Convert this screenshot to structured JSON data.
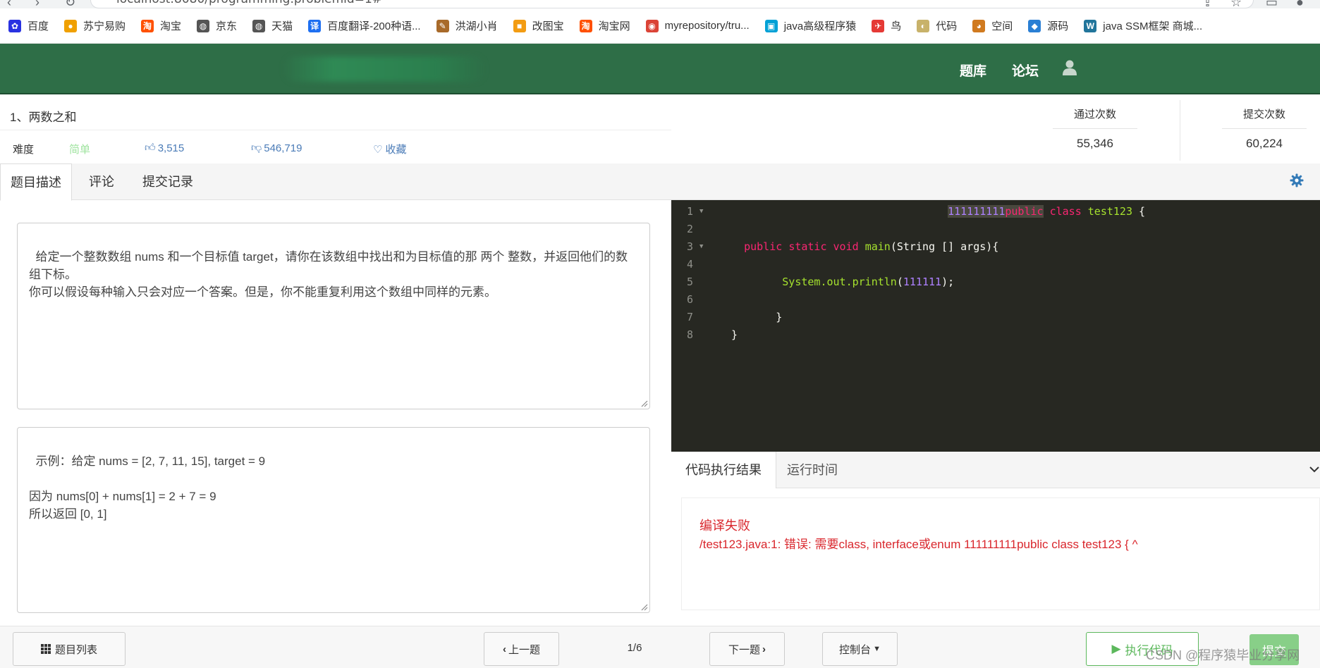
{
  "browser": {
    "url": "localhost:8080/programming.problemid=1#"
  },
  "bookmarks": [
    {
      "label": "百度",
      "icon": "baidu-icon",
      "color": "#2932e1",
      "glyph": "✿"
    },
    {
      "label": "苏宁易购",
      "icon": "suning-icon",
      "color": "#f0a000",
      "glyph": "●"
    },
    {
      "label": "淘宝",
      "icon": "taobao-icon",
      "color": "#ff5000",
      "glyph": "淘"
    },
    {
      "label": "京东",
      "icon": "globe-icon",
      "color": "#555555",
      "glyph": "◍"
    },
    {
      "label": "天猫",
      "icon": "globe-icon",
      "color": "#555555",
      "glyph": "◍"
    },
    {
      "label": "百度翻译-200种语...",
      "icon": "translate-icon",
      "color": "#1e6ff1",
      "glyph": "译"
    },
    {
      "label": "洪湖小肖",
      "icon": "bird-icon",
      "color": "#a86a2a",
      "glyph": "✎"
    },
    {
      "label": "改图宝",
      "icon": "gaitubao-icon",
      "color": "#f39c12",
      "glyph": "■"
    },
    {
      "label": "淘宝网",
      "icon": "taobao-icon",
      "color": "#ff5000",
      "glyph": "淘"
    },
    {
      "label": "myrepository/tru...",
      "icon": "chrome-icon",
      "color": "#db4437",
      "glyph": "◉"
    },
    {
      "label": "java高级程序猿",
      "icon": "bilibili-icon",
      "color": "#00a1d6",
      "glyph": "▣"
    },
    {
      "label": "鸟",
      "icon": "bird-icon",
      "color": "#e53935",
      "glyph": "✈"
    },
    {
      "label": "代码",
      "icon": "code-icon",
      "color": "#c8b26a",
      "glyph": "◐"
    },
    {
      "label": "空间",
      "icon": "space-icon",
      "color": "#d07a1f",
      "glyph": "◕"
    },
    {
      "label": "源码",
      "icon": "source-icon",
      "color": "#2a7fd4",
      "glyph": "◆"
    },
    {
      "label": "java SSM框架 商城...",
      "icon": "wordpress-icon",
      "color": "#21759b",
      "glyph": "W"
    }
  ],
  "header": {
    "nav": [
      "题库",
      "论坛"
    ]
  },
  "problem": {
    "title": "1、两数之和",
    "difficulty_label": "难度",
    "difficulty": "简单",
    "likes": "3,515",
    "dislikes": "546,719",
    "favorite": "收藏",
    "pass_label": "通过次数",
    "pass_count": "55,346",
    "submit_label": "提交次数",
    "submit_count": "60,224"
  },
  "tabs": [
    "题目描述",
    "评论",
    "提交记录"
  ],
  "description": "给定一个整数数组 nums 和一个目标值 target，请你在该数组中找出和为目标值的那 两个 整数，并返回他们的数组下标。\n你可以假设每种输入只会对应一个答案。但是，你不能重复利用这个数组中同样的元素。",
  "example": "示例：给定 nums = [2, 7, 11, 15], target = 9\n\n因为 nums[0] + nums[1] = 2 + 7 = 9\n所以返回 [0, 1]",
  "code_lines": [
    {
      "n": "1",
      "fold": true,
      "indent": "                                   ",
      "tokens": [
        {
          "t": "111111111",
          "c": "tok-num tok-sel"
        },
        {
          "t": "public",
          "c": "tok-kw tok-sel"
        },
        {
          "t": " ",
          "c": "tok-pl"
        },
        {
          "t": "class",
          "c": "tok-kw"
        },
        {
          "t": " ",
          "c": "tok-pl"
        },
        {
          "t": "test123",
          "c": "tok-cls"
        },
        {
          "t": " {",
          "c": "tok-pl"
        }
      ]
    },
    {
      "n": "2",
      "fold": false,
      "indent": "",
      "tokens": []
    },
    {
      "n": "3",
      "fold": true,
      "indent": "   ",
      "tokens": [
        {
          "t": "public",
          "c": "tok-kw"
        },
        {
          "t": " ",
          "c": "tok-pl"
        },
        {
          "t": "static",
          "c": "tok-kw"
        },
        {
          "t": " ",
          "c": "tok-pl"
        },
        {
          "t": "void",
          "c": "tok-kw"
        },
        {
          "t": " ",
          "c": "tok-pl"
        },
        {
          "t": "main",
          "c": "tok-cls"
        },
        {
          "t": "(String [] args){",
          "c": "tok-pl"
        }
      ]
    },
    {
      "n": "4",
      "fold": false,
      "indent": "",
      "tokens": []
    },
    {
      "n": "5",
      "fold": false,
      "indent": "         ",
      "tokens": [
        {
          "t": "System.out.println",
          "c": "tok-cls"
        },
        {
          "t": "(",
          "c": "tok-pl"
        },
        {
          "t": "111111",
          "c": "tok-num"
        },
        {
          "t": ");",
          "c": "tok-pl"
        }
      ]
    },
    {
      "n": "6",
      "fold": false,
      "indent": "",
      "tokens": []
    },
    {
      "n": "7",
      "fold": false,
      "indent": "        ",
      "tokens": [
        {
          "t": "}",
          "c": "tok-pl"
        }
      ]
    },
    {
      "n": "8",
      "fold": false,
      "indent": " ",
      "tokens": [
        {
          "t": "}",
          "c": "tok-pl"
        }
      ]
    }
  ],
  "result": {
    "tabs": [
      "代码执行结果",
      "运行时间"
    ],
    "status": "编译失败",
    "message": "/test123.java:1: 错误: 需要class, interface或enum 111111111public class test123 { ^"
  },
  "footer": {
    "list_button": "题目列表",
    "prev_button": "上一题",
    "pager": "1/6",
    "next_button": "下一题",
    "console_button": "控制台",
    "run_button": "执行代码",
    "submit_button": "提交"
  },
  "watermark": "CSDN @程序猿毕业分享网",
  "colors": {
    "header_green": "#2e6e47",
    "difficulty_green": "#5cb85c",
    "link_blue": "#4a7bb7",
    "error_red": "#d9262c",
    "run_green": "#5cb85c"
  }
}
